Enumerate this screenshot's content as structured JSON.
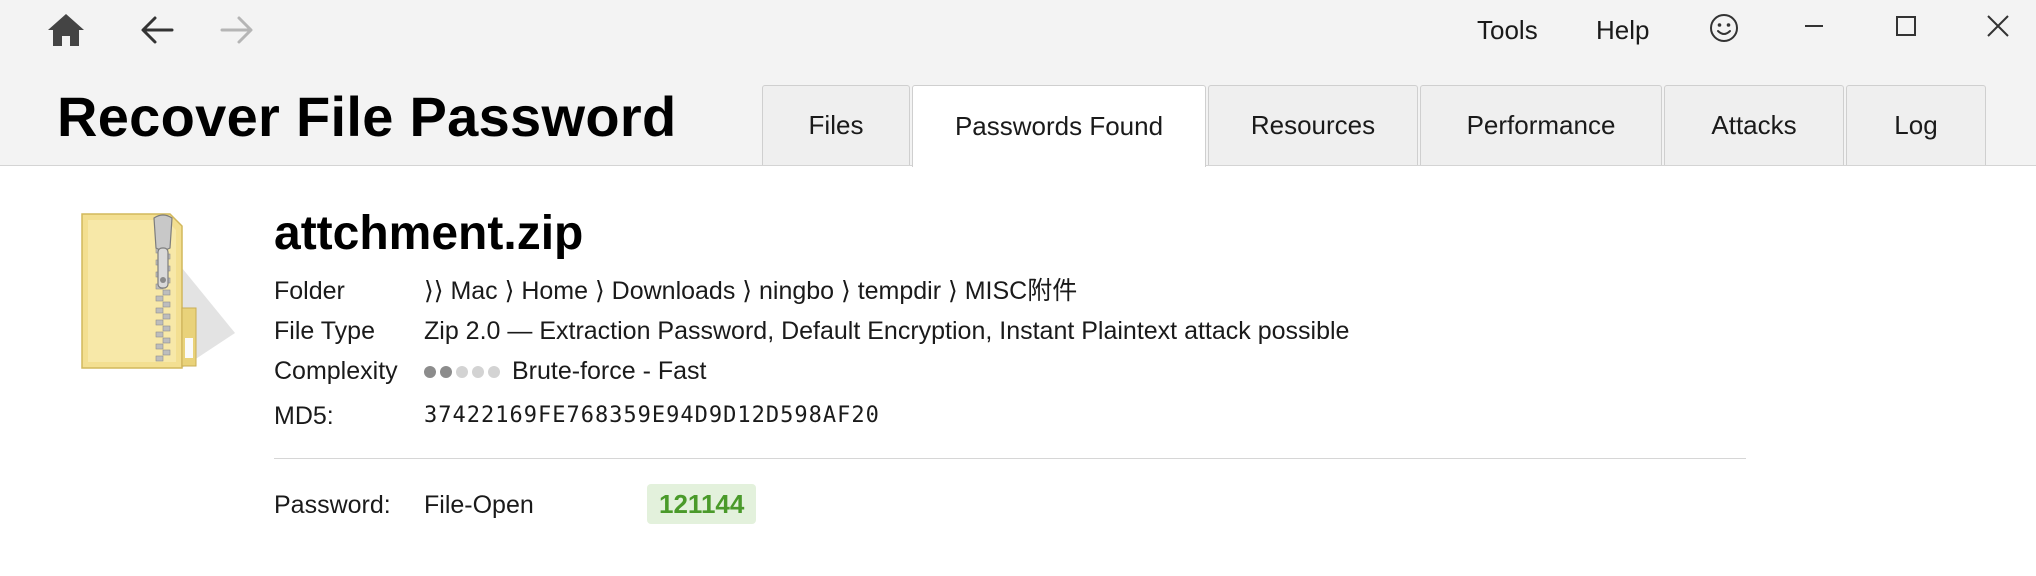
{
  "nav": {
    "home_icon": "home-icon",
    "back_icon": "arrow-left-icon",
    "forward_icon": "arrow-right-icon"
  },
  "menu": {
    "tools": "Tools",
    "help": "Help",
    "feedback_icon": "smiley-icon"
  },
  "window_controls": [
    "minimize-icon",
    "maximize-icon",
    "close-icon"
  ],
  "app_title": "Recover File Password",
  "tabs": [
    {
      "label": "Files",
      "active": false
    },
    {
      "label": "Passwords Found",
      "active": true
    },
    {
      "label": "Resources",
      "active": false
    },
    {
      "label": "Performance",
      "active": false
    },
    {
      "label": "Attacks",
      "active": false
    },
    {
      "label": "Log",
      "active": false
    }
  ],
  "file": {
    "name": "attchment.zip",
    "icon": "zip-folder-icon",
    "folder_label": "Folder",
    "folder_path": "⟩⟩ Mac ⟩ Home ⟩ Downloads ⟩ ningbo ⟩ tempdir ⟩ MISC附件",
    "type_label": "File Type",
    "type_value": "Zip 2.0 — Extraction Password, Default Encryption, Instant Plaintext attack possible",
    "complexity_label": "Complexity",
    "complexity_level": 2,
    "complexity_max": 5,
    "complexity_value": "Brute-force - Fast",
    "md5_label": "MD5:",
    "md5_value": "37422169FE768359E94D9D12D598AF20"
  },
  "password": {
    "label": "Password:",
    "kind": "File-Open",
    "value": "121144"
  },
  "colors": {
    "header_bg": "#f3f3f3",
    "password_badge_bg": "#e3f1dc",
    "password_text": "#4a9a2a"
  }
}
